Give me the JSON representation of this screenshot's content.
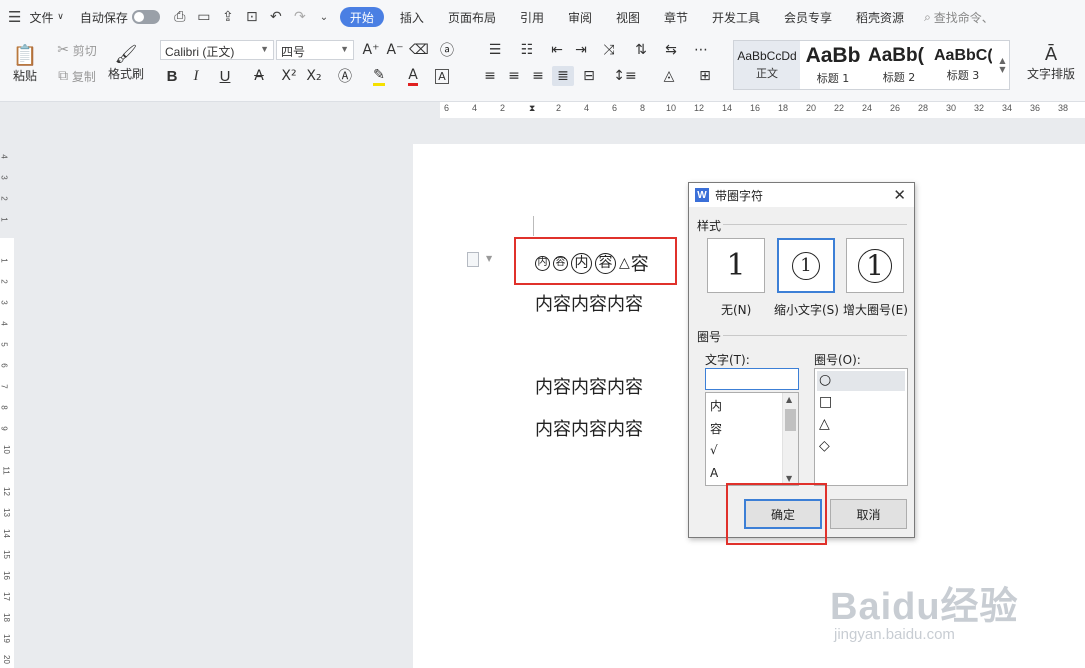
{
  "titlebar": {
    "file_menu": "文件",
    "autosave": "自动保存",
    "tabs": [
      "开始",
      "插入",
      "页面布局",
      "引用",
      "审阅",
      "视图",
      "章节",
      "开发工具",
      "会员专享",
      "稻壳资源"
    ],
    "search_placeholder": "查找命令、"
  },
  "ribbon": {
    "paste": "粘贴",
    "cut": "剪切",
    "copy": "复制",
    "format_painter": "格式刷",
    "font_name": "Calibri (正文)",
    "font_size": "四号",
    "bold": "B",
    "italic": "I",
    "underline": "U",
    "styles": [
      {
        "preview": "AaBbCcDd",
        "name": "正文"
      },
      {
        "preview": "AaBb",
        "name": "标题 1"
      },
      {
        "preview": "AaBb(",
        "name": "标题 2"
      },
      {
        "preview": "AaBbC(",
        "name": "标题 3"
      }
    ],
    "text_layout": "文字排版"
  },
  "ruler": {
    "top_ticks": [
      "6",
      "4",
      "2",
      "2",
      "4",
      "6",
      "8",
      "10",
      "12",
      "14",
      "16",
      "18",
      "20",
      "22",
      "24",
      "26",
      "28",
      "30",
      "32",
      "34",
      "36",
      "38"
    ],
    "left_ticks": [
      "4",
      "3",
      "2",
      "1",
      "1",
      "2",
      "3",
      "4",
      "5",
      "6",
      "7",
      "8",
      "9",
      "10",
      "11",
      "12",
      "13",
      "14",
      "15",
      "16",
      "17",
      "18",
      "19",
      "20"
    ]
  },
  "document": {
    "enclosed_chars": [
      "内",
      "容",
      "内",
      "容"
    ],
    "triangle_char": "容",
    "lines": [
      "内容内容内容",
      "内容内容内容",
      "内容内容内容"
    ]
  },
  "dialog": {
    "title": "带圈字符",
    "close": "✕",
    "style_section": "样式",
    "style_options": [
      {
        "label": "无(N)",
        "preview": "1"
      },
      {
        "label": "缩小文字(S)",
        "preview": "1"
      },
      {
        "label": "增大圈号(E)",
        "preview": "1"
      }
    ],
    "enclosure_section": "圈号",
    "text_label": "文字(T):",
    "text_value": "",
    "text_items": [
      "内",
      "容",
      "√",
      "A"
    ],
    "enclosure_label": "圈号(O):",
    "enclosure_items": [
      "○",
      "□",
      "△",
      "◇"
    ],
    "ok": "确定",
    "cancel": "取消"
  },
  "watermark": {
    "brand": "Baidu经验",
    "url": "jingyan.baidu.com"
  },
  "colors": {
    "accent": "#4a7fe3",
    "highlight_box": "#e0312b",
    "selected_option": "#3c7fd6"
  }
}
